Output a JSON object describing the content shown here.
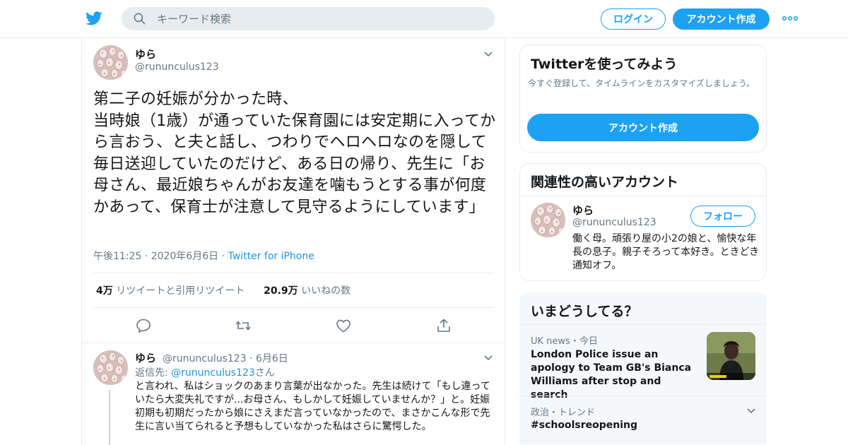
{
  "header": {
    "search_placeholder": "キーワード検索",
    "login_label": "ログイン",
    "signup_label": "アカウント作成",
    "brand_color": "#1da1f2"
  },
  "tweet": {
    "name": "ゆら",
    "handle": "@rununculus123",
    "text": "第二子の妊娠が分かった時、\n当時娘（1歳）が通っていた保育園には安定期に入ってから言おう、と夫と話し、つわりでヘロヘロなのを隠して毎日送迎していたのだけど、ある日の帰り、先生に「お母さん、最近娘ちゃんがお友達を噛もうとする事が何度かあって、保育士が注意して見守るようにしています」",
    "time": "午後11:25",
    "date": "2020年6月6日",
    "source": "Twitter for iPhone",
    "retweets_count": "4万",
    "retweets_label": "リツイートと引用リツイート",
    "likes_count": "20.9万",
    "likes_label": "いいねの数"
  },
  "reply": {
    "name": "ゆら",
    "handle": "@rununculus123",
    "date": "6月6日",
    "reply_to_prefix": "返信先: ",
    "reply_to_handle": "@rununculus123",
    "reply_to_suffix": "さん",
    "text": "と言われ、私はショックのあまり言葉が出なかった。先生は続けて「もし違っていたら大変失礼ですが...お母さん、もしかして妊娠していませんか？」と。妊娠初期も初期だったから娘にさえまだ言っていなかったので、まさかこんな形で先生に言い当てられると予想もしていなかった私はさらに驚愕した。"
  },
  "sidebar": {
    "try": {
      "title": "Twitterを使ってみよう",
      "subtitle": "今すぐ登録して、タイムラインをカスタマイズしましょう。",
      "button": "アカウント作成"
    },
    "related": {
      "title": "関連性の高いアカウント",
      "name": "ゆら",
      "handle": "@rununculus123",
      "follow_label": "フォロー",
      "bio": "働く母。頑張り屋の小2の娘と、愉快な年長の息子。親子そろって本好き。ときどき通知オフ。"
    },
    "trends": {
      "title": "いまどうしてる？",
      "items": [
        {
          "meta": "UK news・今日",
          "title": "London Police issue an apology to Team GB's Bianca Williams after stop and search"
        },
        {
          "meta": "政治・トレンド",
          "title": "#schoolsreopening"
        }
      ]
    }
  }
}
